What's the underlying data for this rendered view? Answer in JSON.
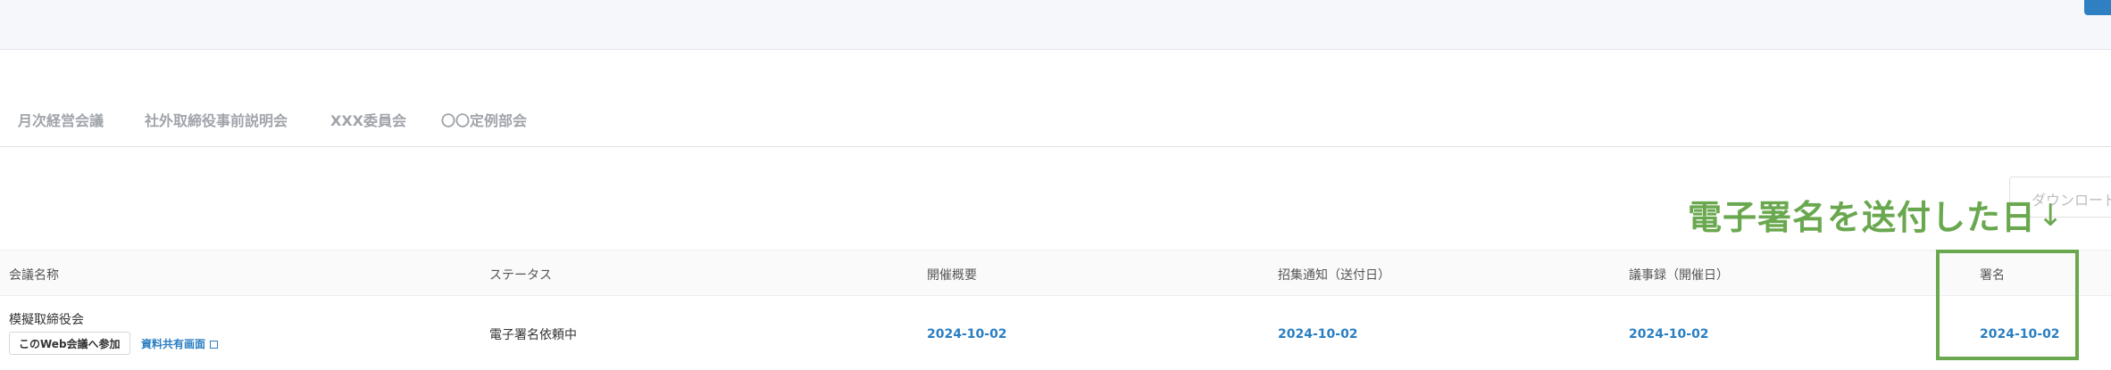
{
  "tabs": [
    "月次経営会議",
    "社外取締役事前説明会",
    "XXX委員会",
    "〇〇定例部会"
  ],
  "download_label": "ダウンロード",
  "annotation": {
    "text": "電子署名を送付した日",
    "arrow": "↓"
  },
  "table": {
    "headers": [
      "会議名称",
      "ステータス",
      "開催概要",
      "招集通知（送付日）",
      "議事録（開催日）",
      "署名"
    ],
    "rows": [
      {
        "name": "模擬取締役会",
        "join_button": "このWeb会議へ参加",
        "share_link": "資料共有画面",
        "status": "電子署名依頼中",
        "overview_date": "2024-10-02",
        "notice_date": "2024-10-02",
        "minutes_date": "2024-10-02",
        "signature_date": "2024-10-02"
      }
    ]
  },
  "colors": {
    "accent": "#2a7ec2",
    "annotation": "#6aa84f",
    "tab_text": "#a0a4aa"
  }
}
